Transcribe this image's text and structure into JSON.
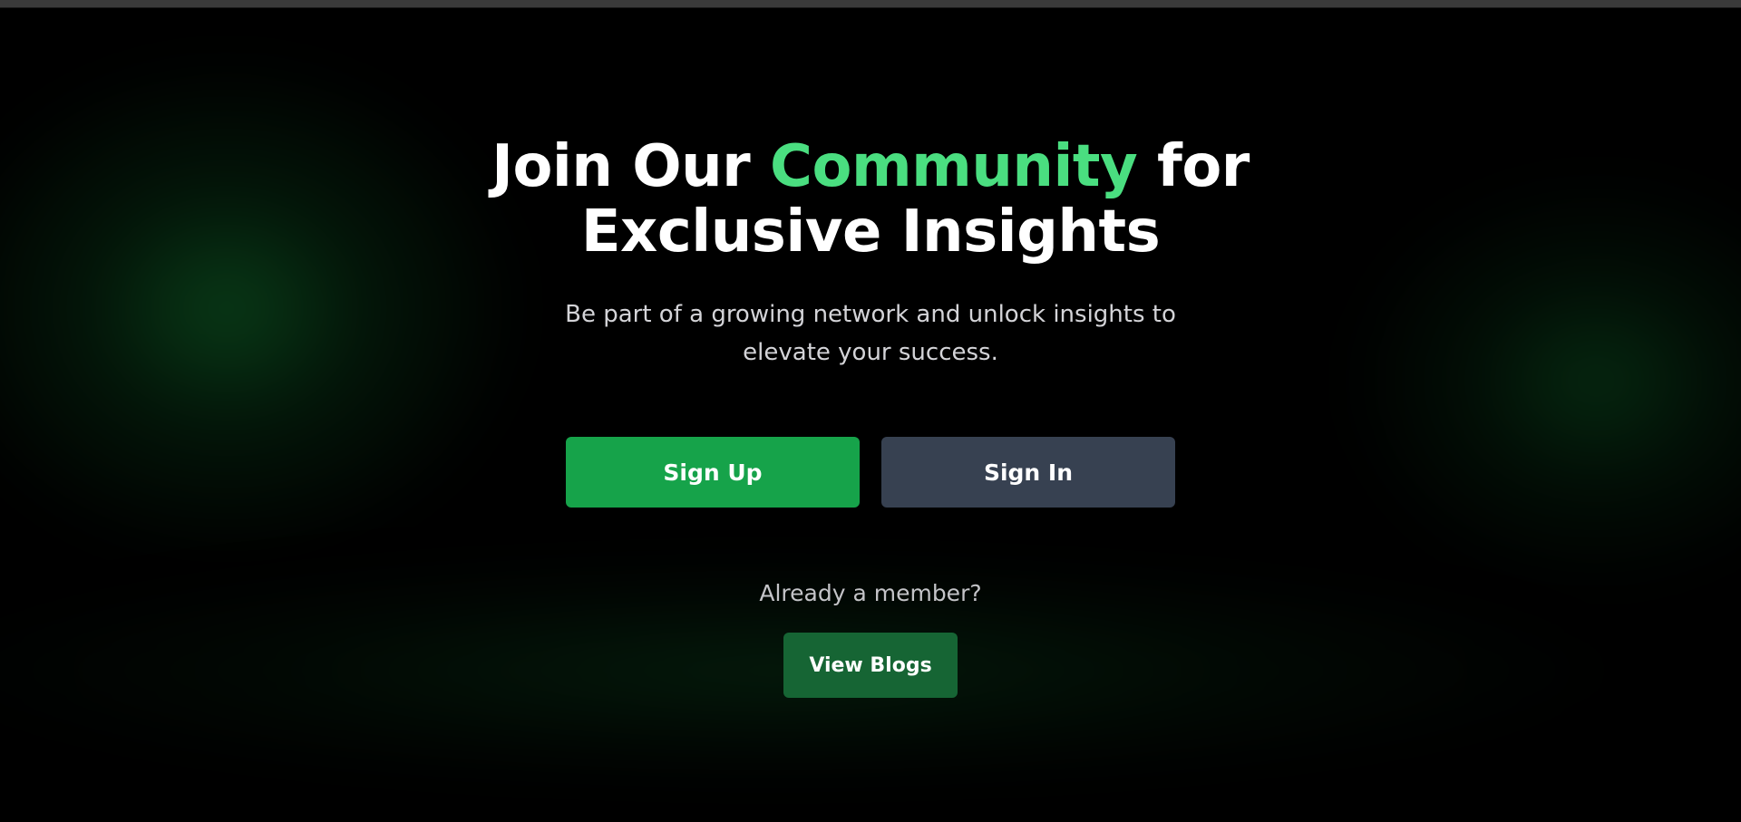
{
  "hero": {
    "title_before": "Join Our ",
    "title_accent": "Community",
    "title_after_line1": " for",
    "title_line2": "Exclusive Insights",
    "subtitle_line1": "Be part of a growing network and unlock insights to",
    "subtitle_line2": "elevate your success."
  },
  "actions": {
    "signup_label": "Sign Up",
    "signin_label": "Sign In"
  },
  "member": {
    "prompt": "Already a member?",
    "view_blogs_label": "View Blogs"
  },
  "colors": {
    "background": "#000000",
    "accent_green": "#4ade80",
    "signup_bg": "#16a34a",
    "signin_bg": "#374151",
    "view_blogs_bg": "#166534"
  }
}
